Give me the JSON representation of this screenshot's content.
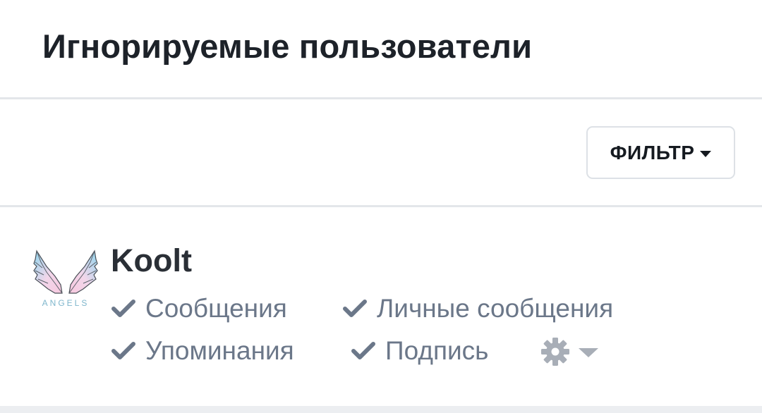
{
  "page": {
    "title": "Игнорируемые пользователи"
  },
  "filter": {
    "label": "ФИЛЬТР"
  },
  "user": {
    "name": "Koolt",
    "avatar_text": "ANGELS",
    "options": [
      {
        "label": "Сообщения",
        "checked": true
      },
      {
        "label": "Личные сообщения",
        "checked": true
      },
      {
        "label": "Упоминания",
        "checked": true
      },
      {
        "label": "Подпись",
        "checked": true
      }
    ]
  },
  "colors": {
    "accent_text": "#6b7789",
    "divider": "#e3e6ea",
    "gear": "#a8aeb7"
  },
  "icons": {
    "check": "check-icon",
    "settings": "gear-icon",
    "dropdown": "caret-down-icon"
  }
}
